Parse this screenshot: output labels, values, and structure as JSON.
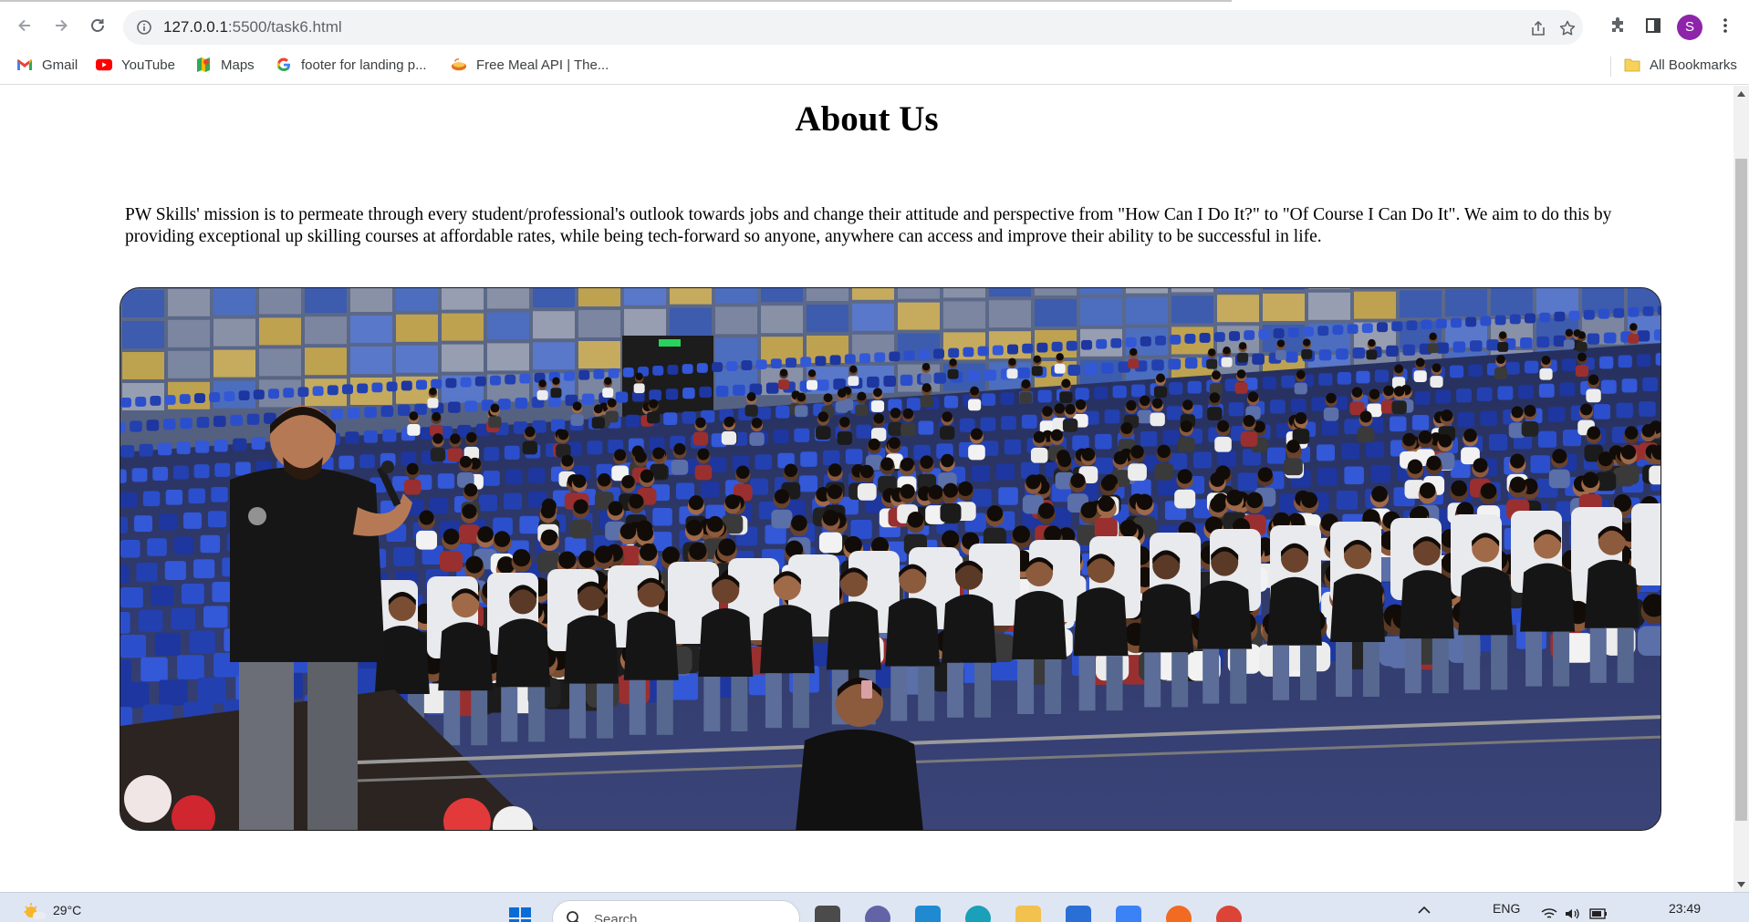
{
  "browser": {
    "url_host": "127.0.0.1",
    "url_path": ":5500/task6.html",
    "profile_initial": "S",
    "bookmarks": [
      {
        "label": "Gmail",
        "icon": "gmail-icon"
      },
      {
        "label": "YouTube",
        "icon": "youtube-icon"
      },
      {
        "label": "Maps",
        "icon": "maps-icon"
      },
      {
        "label": "footer for landing p...",
        "icon": "google-icon"
      },
      {
        "label": "Free Meal API | The...",
        "icon": "meal-icon"
      }
    ],
    "all_bookmarks": "All Bookmarks"
  },
  "page": {
    "title": "About Us",
    "paragraph": "PW Skills' mission is to permeate through every student/professional's outlook towards jobs and change their attitude and perspective from \"How Can I Do It?\" to \"Of Course I Can Do It\". We aim to do this by providing exceptional up skilling courses at affordable rates, while being tech-forward so anyone, anywhere can access and improve their ability to be successful in life.",
    "image_alt": "Speaker addressing a large audience in an auditorium"
  },
  "taskbar": {
    "temperature": "29°C",
    "search_placeholder": "Search",
    "language": "ENG",
    "time": "23:49"
  },
  "colors": {
    "accent_profile": "#8e24aa",
    "seat_blue": "#2742b8"
  }
}
